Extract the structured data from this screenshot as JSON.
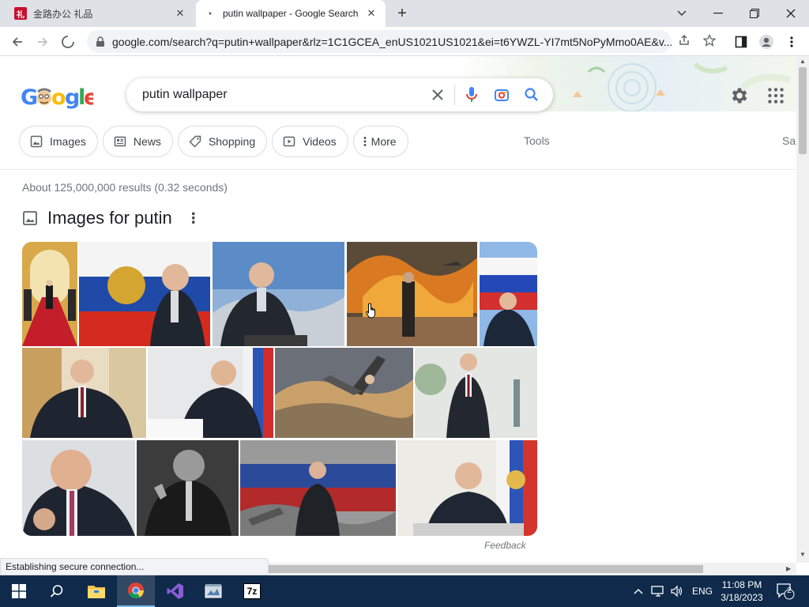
{
  "browser": {
    "tabs": [
      {
        "title": "金路办公 礼品",
        "favicon": "红-logo-icon"
      },
      {
        "title": "putin wallpaper - Google Search",
        "favicon": "loading-icon"
      }
    ],
    "url": "google.com/search?q=putin+wallpaper&rlz=1C1GCEA_enUS1021US1021&ei=t6YWZL-YI7mt5NoPyMmo0AE&v...",
    "status": "Establishing secure connection..."
  },
  "search": {
    "query": "putin wallpaper",
    "logo_text": "Google"
  },
  "chips": [
    {
      "label": "Images",
      "icon": "image-icon"
    },
    {
      "label": "News",
      "icon": "news-icon"
    },
    {
      "label": "Shopping",
      "icon": "tag-icon"
    },
    {
      "label": "Videos",
      "icon": "play-icon"
    },
    {
      "label": "More",
      "icon": "vertical-dots-icon"
    }
  ],
  "tools_label": "Tools",
  "truncated_label": "Sa",
  "results": {
    "stats": "About 125,000,000 results (0.32 seconds)",
    "images_heading": "Images for putin",
    "feedback": "Feedback"
  },
  "taskbar": {
    "lang": "ENG",
    "time": "11:08 PM",
    "date": "3/18/2023",
    "notification_count": "2",
    "apps": [
      "file-explorer-icon",
      "chrome-icon",
      "visual-studio-icon",
      "app-icon",
      "7zip-icon"
    ],
    "zip_label": "7z"
  },
  "colors": {
    "accent": "#1a73e8",
    "taskbar": "#0f2a4a"
  }
}
